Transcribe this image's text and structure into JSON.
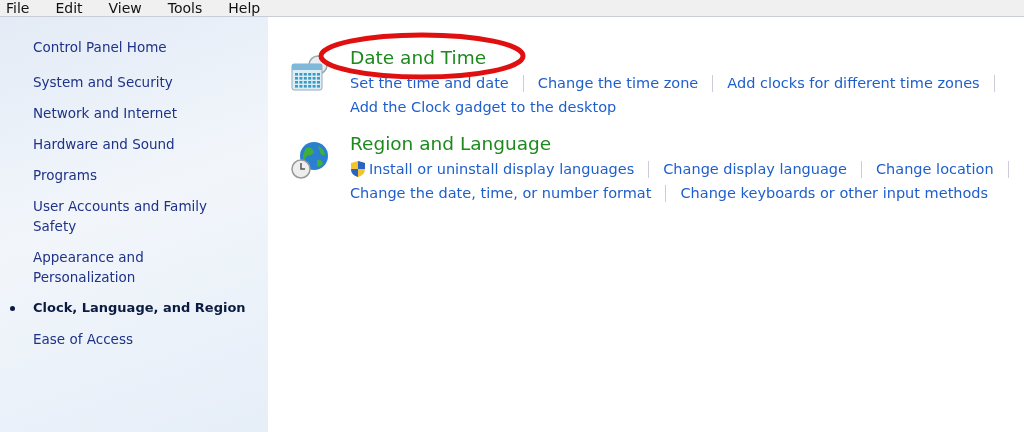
{
  "menu": [
    "File",
    "Edit",
    "View",
    "Tools",
    "Help"
  ],
  "sidebar": {
    "home": "Control Panel Home",
    "items": [
      {
        "label": "System and Security",
        "selected": false
      },
      {
        "label": "Network and Internet",
        "selected": false
      },
      {
        "label": "Hardware and Sound",
        "selected": false
      },
      {
        "label": "Programs",
        "selected": false
      },
      {
        "label": "User Accounts and Family Safety",
        "selected": false
      },
      {
        "label": "Appearance and Personalization",
        "selected": false
      },
      {
        "label": "Clock, Language, and Region",
        "selected": true
      },
      {
        "label": "Ease of Access",
        "selected": false
      }
    ]
  },
  "categories": [
    {
      "title": "Date and Time",
      "kind": "calendar",
      "highlighted": true,
      "link_rows": [
        [
          {
            "label": "Set the time and date",
            "shield": false
          },
          {
            "label": "Change the time zone",
            "shield": false
          },
          {
            "label": "Add clocks for different time zones",
            "shield": false
          }
        ],
        [
          {
            "label": "Add the Clock gadget to the desktop",
            "shield": false
          }
        ]
      ]
    },
    {
      "title": "Region and Language",
      "kind": "globe",
      "highlighted": false,
      "link_rows": [
        [
          {
            "label": "Install or uninstall display languages",
            "shield": true
          },
          {
            "label": "Change display language",
            "shield": false
          },
          {
            "label": "Change location",
            "shield": false
          }
        ],
        [
          {
            "label": "Change the date, time, or number format",
            "shield": false
          },
          {
            "label": "Change keyboards or other input methods",
            "shield": false
          }
        ]
      ]
    }
  ]
}
